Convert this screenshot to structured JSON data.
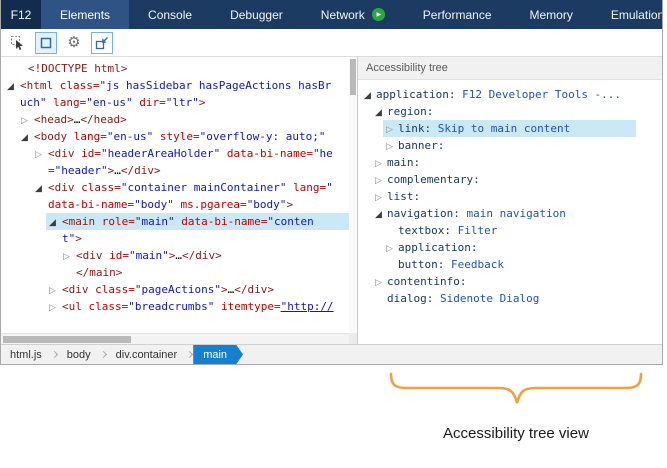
{
  "window": {
    "menu_label": "F12"
  },
  "icons": {
    "gear": "⚙",
    "play": "▶",
    "expanded": "◢",
    "collapsed": "▷"
  },
  "tabs": {
    "items": [
      {
        "label": "Elements",
        "active": true
      },
      {
        "label": "Console"
      },
      {
        "label": "Debugger"
      },
      {
        "label": "Network",
        "icon": "play-circle"
      },
      {
        "label": "Performance"
      },
      {
        "label": "Memory"
      },
      {
        "label": "Emulation"
      }
    ]
  },
  "toolbar": {
    "icons": [
      "select-element-icon",
      "highlight-elements-icon",
      "gear-icon",
      "dom-highlight-icon"
    ]
  },
  "dom_tree": {
    "lines": [
      {
        "ind": 0,
        "pad": 8,
        "tokens": [
          {
            "t": "tag",
            "s": "<!DOCTYPE html>"
          }
        ]
      },
      {
        "ind": 0,
        "arrow": "exp",
        "tokens": [
          {
            "t": "tag",
            "s": "<html "
          },
          {
            "t": "attr",
            "s": "class="
          },
          {
            "t": "val",
            "s": "\"js hasSidebar hasPageActions hasBr"
          }
        ]
      },
      {
        "ind": 0,
        "tokens": [
          {
            "t": "val",
            "s": "uch\" "
          },
          {
            "t": "attr",
            "s": "lang="
          },
          {
            "t": "val",
            "s": "\"en-us\" "
          },
          {
            "t": "attr",
            "s": "dir="
          },
          {
            "t": "val",
            "s": "\"ltr\""
          },
          {
            "t": "tag",
            "s": ">"
          }
        ]
      },
      {
        "ind": 1,
        "arrow": "col",
        "tokens": [
          {
            "t": "tag",
            "s": "<head>"
          },
          {
            "t": "plain",
            "s": "…"
          },
          {
            "t": "tag",
            "s": "</head>"
          }
        ]
      },
      {
        "ind": 1,
        "arrow": "exp",
        "tokens": [
          {
            "t": "tag",
            "s": "<body "
          },
          {
            "t": "attr",
            "s": "lang="
          },
          {
            "t": "val",
            "s": "\"en-us\" "
          },
          {
            "t": "attr",
            "s": "style="
          },
          {
            "t": "val",
            "s": "\"overflow-y: auto;\""
          }
        ]
      },
      {
        "ind": 2,
        "arrow": "col",
        "tokens": [
          {
            "t": "tag",
            "s": "<div "
          },
          {
            "t": "attr",
            "s": "id="
          },
          {
            "t": "val",
            "s": "\"headerAreaHolder\" "
          },
          {
            "t": "attr",
            "s": "data-bi-name="
          },
          {
            "t": "val",
            "s": "\"he"
          }
        ]
      },
      {
        "ind": 2,
        "tokens": [
          {
            "t": "attr",
            "s": "="
          },
          {
            "t": "val",
            "s": "\"header\""
          },
          {
            "t": "tag",
            "s": ">"
          },
          {
            "t": "plain",
            "s": "…"
          },
          {
            "t": "tag",
            "s": "</div>"
          }
        ]
      },
      {
        "ind": 2,
        "arrow": "exp",
        "tokens": [
          {
            "t": "tag",
            "s": "<div "
          },
          {
            "t": "attr",
            "s": "class="
          },
          {
            "t": "val",
            "s": "\"container mainContainer\" "
          },
          {
            "t": "attr",
            "s": "lang="
          },
          {
            "t": "val",
            "s": "\""
          }
        ]
      },
      {
        "ind": 2,
        "tokens": [
          {
            "t": "attr",
            "s": "data-bi-name="
          },
          {
            "t": "val",
            "s": "\"body\" "
          },
          {
            "t": "attr",
            "s": "ms.pgarea="
          },
          {
            "t": "val",
            "s": "\"body\""
          },
          {
            "t": "tag",
            "s": ">"
          }
        ]
      },
      {
        "ind": 3,
        "arrow": "exp",
        "sel": true,
        "selFrom": 45,
        "tokens": [
          {
            "t": "tag",
            "s": "<main "
          },
          {
            "t": "attr",
            "s": "role="
          },
          {
            "t": "val",
            "s": "\"main\" "
          },
          {
            "t": "attr",
            "s": "data-bi-name="
          },
          {
            "t": "val",
            "s": "\"conten"
          }
        ]
      },
      {
        "ind": 3,
        "tokens": [
          {
            "t": "val",
            "s": "t\""
          },
          {
            "t": "tag",
            "s": ">"
          }
        ]
      },
      {
        "ind": 4,
        "arrow": "col",
        "tokens": [
          {
            "t": "tag",
            "s": "<div "
          },
          {
            "t": "attr",
            "s": "id="
          },
          {
            "t": "val",
            "s": "\"main\""
          },
          {
            "t": "tag",
            "s": ">"
          },
          {
            "t": "plain",
            "s": "…"
          },
          {
            "t": "tag",
            "s": "</div>"
          }
        ]
      },
      {
        "ind": 4,
        "tokens": [
          {
            "t": "tag",
            "s": "</main>"
          }
        ]
      },
      {
        "ind": 3,
        "arrow": "col",
        "tokens": [
          {
            "t": "tag",
            "s": "<div "
          },
          {
            "t": "attr",
            "s": "class="
          },
          {
            "t": "val",
            "s": "\"pageActions\""
          },
          {
            "t": "tag",
            "s": ">"
          },
          {
            "t": "plain",
            "s": "…"
          },
          {
            "t": "tag",
            "s": "</div>"
          }
        ]
      },
      {
        "ind": 3,
        "arrow": "col",
        "tokens": [
          {
            "t": "tag",
            "s": "<ul "
          },
          {
            "t": "attr",
            "s": "class="
          },
          {
            "t": "val",
            "s": "\"breadcrumbs\" "
          },
          {
            "t": "attr",
            "s": "itemtype="
          },
          {
            "t": "link",
            "s": "\"http://"
          }
        ]
      }
    ]
  },
  "accessibility": {
    "header": "Accessibility tree",
    "lines": [
      {
        "ind": 0,
        "arrow": "exp",
        "role": "application:",
        "value": "F12 Developer Tools -..."
      },
      {
        "ind": 1,
        "arrow": "exp",
        "role": "region:",
        "value": ""
      },
      {
        "ind": 2,
        "arrow": "col",
        "sel": true,
        "selFrom": 25,
        "selTo": 278,
        "role": "link:",
        "value": "Skip to main content"
      },
      {
        "ind": 2,
        "arrow": "col",
        "role": "banner:",
        "value": ""
      },
      {
        "ind": 1,
        "arrow": "col",
        "role": "main:",
        "value": ""
      },
      {
        "ind": 1,
        "arrow": "col",
        "role": "complementary:",
        "value": ""
      },
      {
        "ind": 1,
        "arrow": "col",
        "role": "list:",
        "value": ""
      },
      {
        "ind": 1,
        "arrow": "exp",
        "role": "navigation:",
        "value": "main navigation"
      },
      {
        "ind": 2,
        "role": "textbox:",
        "value": "Filter"
      },
      {
        "ind": 2,
        "arrow": "col",
        "role": "application:",
        "value": ""
      },
      {
        "ind": 2,
        "role": "button:",
        "value": "Feedback"
      },
      {
        "ind": 1,
        "arrow": "col",
        "role": "contentinfo:",
        "value": ""
      },
      {
        "ind": 1,
        "role": "dialog:",
        "value": "Sidenote Dialog"
      }
    ]
  },
  "breadcrumb": {
    "items": [
      {
        "label": "html.js"
      },
      {
        "label": "body"
      },
      {
        "label": "div.container"
      },
      {
        "label": "main",
        "active": true
      }
    ]
  },
  "annotation": {
    "label": "Accessibility tree view"
  },
  "colors": {
    "topbar_bg": "#1C3B63",
    "f12_bg": "#122C4E",
    "tab_active_bg": "#2E5384",
    "green_play": "#2EA83C",
    "selection": "#CBE8F6",
    "tag": "#8A1A1A",
    "attr": "#C00000",
    "value": "#1414C8",
    "a11y_role": "#1B3A61",
    "a11y_value": "#2053B8",
    "crumb_active_bg": "#1580D0",
    "brace": "#EFA13E"
  }
}
